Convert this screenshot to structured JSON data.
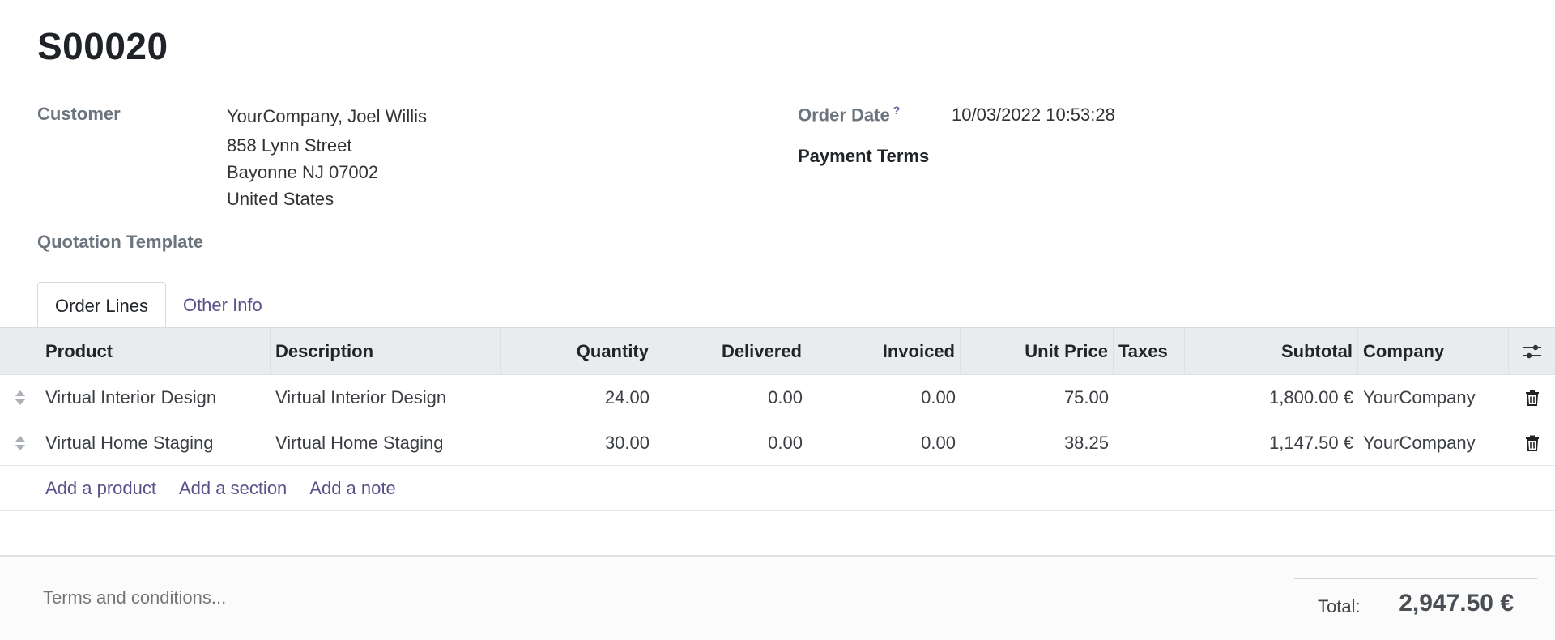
{
  "record": {
    "title": "S00020"
  },
  "customer": {
    "label": "Customer",
    "name": "YourCompany, Joel Willis",
    "address_line1": "858 Lynn Street",
    "address_line2": "Bayonne NJ 07002",
    "address_line3": "United States"
  },
  "quotation_template": {
    "label": "Quotation Template"
  },
  "order_date": {
    "label": "Order Date",
    "help": "?",
    "value": "10/03/2022 10:53:28"
  },
  "payment_terms": {
    "label": "Payment Terms"
  },
  "tabs": [
    {
      "label": "Order Lines",
      "active": true
    },
    {
      "label": "Other Info",
      "active": false
    }
  ],
  "table": {
    "headers": {
      "product": "Product",
      "description": "Description",
      "quantity": "Quantity",
      "delivered": "Delivered",
      "invoiced": "Invoiced",
      "unit_price": "Unit Price",
      "taxes": "Taxes",
      "subtotal": "Subtotal",
      "company": "Company"
    },
    "rows": [
      {
        "product": "Virtual Interior Design",
        "description": "Virtual Interior Design",
        "quantity": "24.00",
        "delivered": "0.00",
        "invoiced": "0.00",
        "unit_price": "75.00",
        "taxes": "",
        "subtotal": "1,800.00 €",
        "company": "YourCompany"
      },
      {
        "product": "Virtual Home Staging",
        "description": "Virtual Home Staging",
        "quantity": "30.00",
        "delivered": "0.00",
        "invoiced": "0.00",
        "unit_price": "38.25",
        "taxes": "",
        "subtotal": "1,147.50 €",
        "company": "YourCompany"
      }
    ],
    "add_links": {
      "product": "Add a product",
      "section": "Add a section",
      "note": "Add a note"
    }
  },
  "footer": {
    "terms_placeholder": "Terms and conditions...",
    "total_label": "Total:",
    "total_value": "2,947.50 €"
  },
  "icons": {
    "drag_handle": "drag-handle-icon",
    "trash": "trash-icon",
    "optional_columns": "settings-sliders-icon"
  },
  "colors": {
    "link": "#5d4f8a",
    "header_bg": "#e9ecef",
    "muted_label": "#6c757d"
  }
}
